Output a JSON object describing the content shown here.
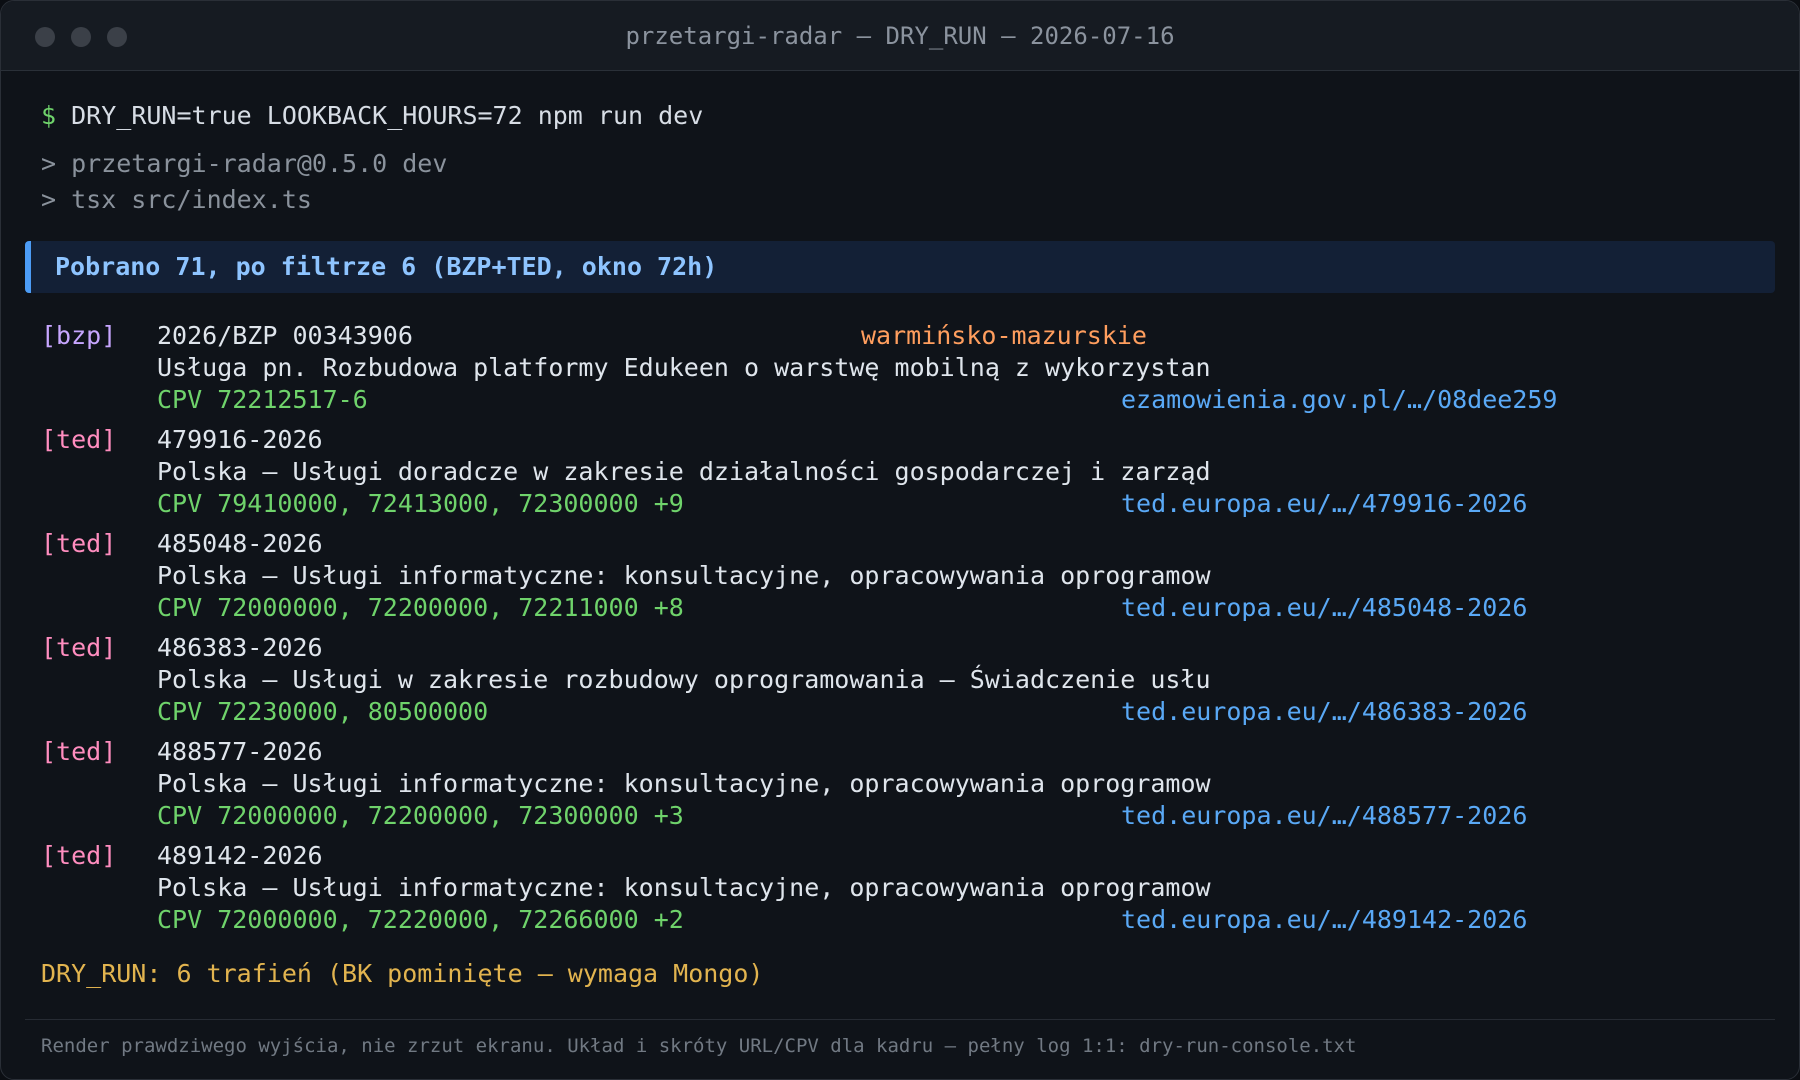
{
  "window": {
    "title": "przetargi-radar — DRY_RUN — 2026-07-16"
  },
  "terminal": {
    "prompt": "$",
    "command": " DRY_RUN=true LOOKBACK_HOURS=72 npm run dev",
    "npm_lines": [
      "> przetargi-radar@0.5.0 dev",
      "> tsx src/index.ts"
    ],
    "banner": "Pobrano 71, po filtrze 6 (BZP+TED, okno 72h)",
    "entries": [
      {
        "source": "[bzp]",
        "id": "2026/BZP 00343906",
        "region": "warmińsko-mazurskie",
        "description": "Usługa pn. Rozbudowa platformy Edukeen o warstwę mobilną z wykorzystan",
        "cpv": "CPV 72212517-6",
        "url": "ezamowienia.gov.pl/…/08dee259"
      },
      {
        "source": "[ted]",
        "id": "479916-2026",
        "region": "",
        "description": "Polska – Usługi doradcze w zakresie działalności gospodarczej i zarząd",
        "cpv": "CPV 79410000, 72413000, 72300000 +9",
        "url": "ted.europa.eu/…/479916-2026"
      },
      {
        "source": "[ted]",
        "id": "485048-2026",
        "region": "",
        "description": "Polska – Usługi informatyczne: konsultacyjne, opracowywania oprogramow",
        "cpv": "CPV 72000000, 72200000, 72211000 +8",
        "url": "ted.europa.eu/…/485048-2026"
      },
      {
        "source": "[ted]",
        "id": "486383-2026",
        "region": "",
        "description": "Polska – Usługi w zakresie rozbudowy oprogramowania – Świadczenie usłu",
        "cpv": "CPV 72230000, 80500000",
        "url": "ted.europa.eu/…/486383-2026"
      },
      {
        "source": "[ted]",
        "id": "488577-2026",
        "region": "",
        "description": "Polska – Usługi informatyczne: konsultacyjne, opracowywania oprogramow",
        "cpv": "CPV 72000000, 72200000, 72300000 +3",
        "url": "ted.europa.eu/…/488577-2026"
      },
      {
        "source": "[ted]",
        "id": "489142-2026",
        "region": "",
        "description": "Polska – Usługi informatyczne: konsultacyjne, opracowywania oprogramow",
        "cpv": "CPV 72000000, 72220000, 72266000 +2",
        "url": "ted.europa.eu/…/489142-2026"
      }
    ],
    "summary": "DRY_RUN: 6 trafień (BK pominięte – wymaga Mongo)",
    "footer": "Render prawdziwego wyjścia, nie zrzut ekranu. Układ i skróty URL/CPV dla kadru – pełny log 1:1: dry-run-console.txt"
  },
  "colors": {
    "background": "#0f1319",
    "prompt": "#6fd36b",
    "banner_text": "#8ec4ff",
    "banner_accent": "#4c9cf5",
    "bzp_tag": "#c7a6ff",
    "ted_tag": "#ff8dbf",
    "region": "#ff9e5e",
    "cpv": "#6fd36b",
    "url": "#5aa9f6",
    "summary": "#e2b44f"
  }
}
